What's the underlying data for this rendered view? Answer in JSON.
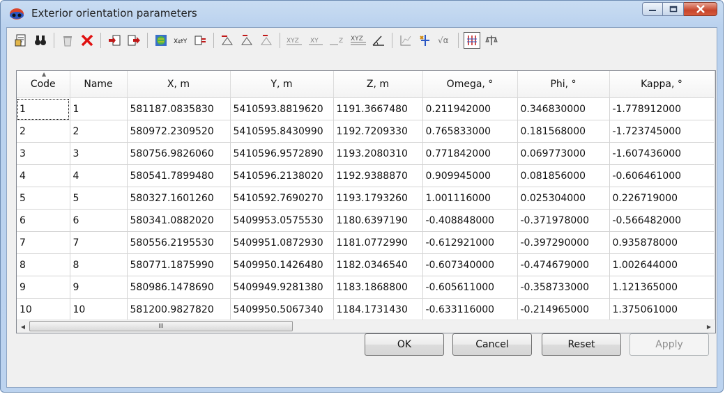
{
  "window": {
    "title": "Exterior orientation parameters"
  },
  "window_buttons": {
    "minimize": "minimize",
    "maximize": "maximize",
    "close": "close"
  },
  "toolbar": {
    "items": [
      "open-file-icon",
      "binoculars-icon",
      "delete-icon",
      "delete-red-x-icon",
      "import-icon",
      "export-icon",
      "globe-icon",
      "swap-xy-icon",
      "coordinate-transform-icon",
      "compute-icon",
      "compute-icon-2",
      "compute-icon-3",
      "xyz-icon",
      "xy-icon",
      "z-icon",
      "xyz-grid-icon",
      "angles-icon",
      "chart-icon",
      "axis-icon",
      "sqrt-alpha-icon",
      "columns-toggle-icon",
      "balance-icon"
    ],
    "xyz_label": "XYZ",
    "xy_label": "XY",
    "z_label": "Z",
    "sqrt_label": "√α"
  },
  "table": {
    "columns": [
      "Code",
      "Name",
      "X, m",
      "Y, m",
      "Z, m",
      "Omega, °",
      "Phi, °",
      "Kappa, °"
    ],
    "rows": [
      [
        "1",
        "1",
        "581187.0835830",
        "5410593.8819620",
        "1191.3667480",
        "0.211942000",
        "0.346830000",
        "-1.778912000"
      ],
      [
        "2",
        "2",
        "580972.2309520",
        "5410595.8430990",
        "1192.7209330",
        "0.765833000",
        "0.181568000",
        "-1.723745000"
      ],
      [
        "3",
        "3",
        "580756.9826060",
        "5410596.9572890",
        "1193.2080310",
        "0.771842000",
        "0.069773000",
        "-1.607436000"
      ],
      [
        "4",
        "4",
        "580541.7899480",
        "5410596.2138020",
        "1192.9388870",
        "0.909945000",
        "0.081856000",
        "-0.606461000"
      ],
      [
        "5",
        "5",
        "580327.1601260",
        "5410592.7690270",
        "1193.1793260",
        "1.001116000",
        "0.025304000",
        "0.226719000"
      ],
      [
        "6",
        "6",
        "580341.0882020",
        "5409953.0575530",
        "1180.6397190",
        "-0.408848000",
        "-0.371978000",
        "-0.566482000"
      ],
      [
        "7",
        "7",
        "580556.2195530",
        "5409951.0872930",
        "1181.0772990",
        "-0.612921000",
        "-0.397290000",
        "0.935878000"
      ],
      [
        "8",
        "8",
        "580771.1875990",
        "5409950.1426480",
        "1182.0346540",
        "-0.607340000",
        "-0.474679000",
        "1.002644000"
      ],
      [
        "9",
        "9",
        "580986.1478690",
        "5409949.9281380",
        "1183.1868800",
        "-0.605611000",
        "-0.358733000",
        "1.121365000"
      ],
      [
        "10",
        "10",
        "581200.9827820",
        "5409950.5067340",
        "1184.1731430",
        "-0.633116000",
        "-0.214965000",
        "1.375061000"
      ]
    ]
  },
  "scrollbar": {
    "thumb_grip": "III"
  },
  "buttons": {
    "ok": "OK",
    "cancel": "Cancel",
    "reset": "Reset",
    "apply": "Apply"
  }
}
